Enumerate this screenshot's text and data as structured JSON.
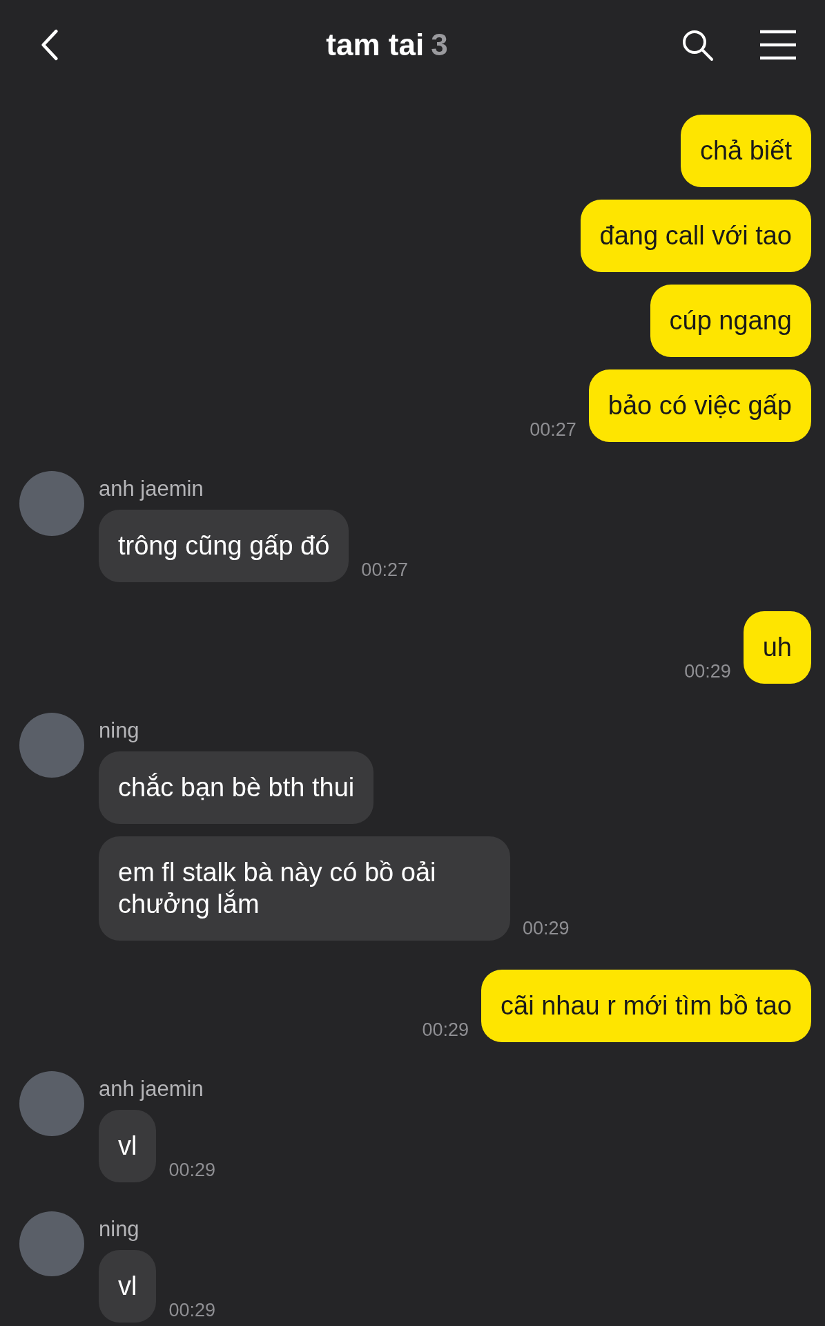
{
  "header": {
    "title": "tam tai",
    "member_count": "3"
  },
  "messages": [
    {
      "kind": "sent",
      "bubbles": [
        "chả biết",
        "đang call với tao",
        "cúp ngang",
        "bảo có việc gấp"
      ],
      "time": "00:27"
    },
    {
      "kind": "received",
      "sender": "anh jaemin",
      "bubbles": [
        "trông cũng gấp đó"
      ],
      "time": "00:27"
    },
    {
      "kind": "sent",
      "bubbles": [
        "uh"
      ],
      "time": "00:29"
    },
    {
      "kind": "received",
      "sender": "ning",
      "bubbles": [
        "chắc bạn bè bth thui",
        "em fl stalk bà này có bồ oải chưởng lắm"
      ],
      "time": "00:29"
    },
    {
      "kind": "sent",
      "bubbles": [
        "cãi nhau r mới tìm bồ tao"
      ],
      "time": "00:29"
    },
    {
      "kind": "received",
      "sender": "anh jaemin",
      "bubbles": [
        "vl"
      ],
      "time": "00:29"
    },
    {
      "kind": "received",
      "sender": "ning",
      "bubbles": [
        "vl"
      ],
      "time": "00:29"
    }
  ]
}
